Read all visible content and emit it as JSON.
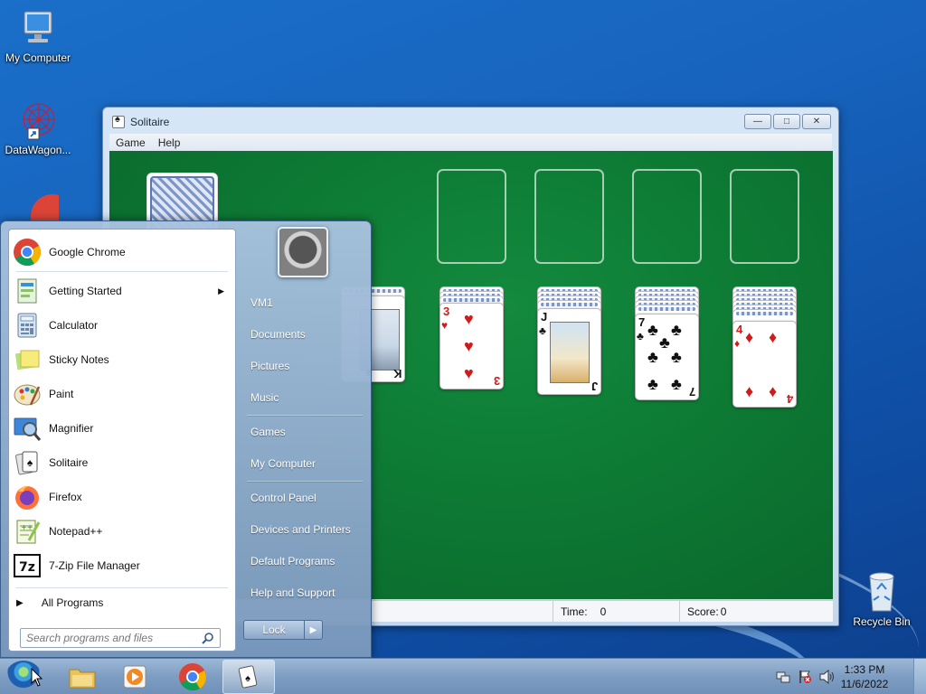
{
  "desktop": {
    "icons": [
      {
        "label": "My Computer",
        "icon": "computer-icon"
      },
      {
        "label": "DataWagon...",
        "icon": "datawagon-icon"
      },
      {
        "label": "Recycle Bin",
        "icon": "recycle-bin-icon"
      }
    ]
  },
  "solitaire": {
    "title": "Solitaire",
    "menu": [
      "Game",
      "Help"
    ],
    "status": {
      "time_label": "Time:",
      "time_value": "0",
      "score_label": "Score:",
      "score_value": "0"
    },
    "visible_cards": [
      {
        "rank": "K",
        "suit": "spades"
      },
      {
        "rank": "3",
        "suit": "hearts"
      },
      {
        "rank": "J",
        "suit": "clubs"
      },
      {
        "rank": "7",
        "suit": "clubs"
      },
      {
        "rank": "4",
        "suit": "diamonds"
      }
    ],
    "colors": {
      "felt": "#0d7a34",
      "red_suit": "#d21a1a"
    }
  },
  "start_menu": {
    "programs": [
      {
        "label": "Google Chrome",
        "icon": "chrome-icon"
      },
      {
        "label": "Getting Started",
        "icon": "getting-started-icon",
        "submenu": true
      },
      {
        "label": "Calculator",
        "icon": "calculator-icon"
      },
      {
        "label": "Sticky Notes",
        "icon": "sticky-notes-icon"
      },
      {
        "label": "Paint",
        "icon": "paint-icon"
      },
      {
        "label": "Magnifier",
        "icon": "magnifier-icon"
      },
      {
        "label": "Solitaire",
        "icon": "solitaire-icon"
      },
      {
        "label": "Firefox",
        "icon": "firefox-icon"
      },
      {
        "label": "Notepad++",
        "icon": "notepadpp-icon"
      },
      {
        "label": "7-Zip File Manager",
        "icon": "7zip-icon"
      }
    ],
    "all_programs": "All Programs",
    "search_placeholder": "Search programs and files",
    "right_links": [
      "VM1",
      "Documents",
      "Pictures",
      "Music",
      "Games",
      "My Computer",
      "Control Panel",
      "Devices and Printers",
      "Default Programs",
      "Help and Support"
    ],
    "lock_label": "Lock"
  },
  "taskbar": {
    "pinned": [
      "explorer-icon",
      "media-player-icon",
      "chrome-icon",
      "solitaire-icon"
    ],
    "clock": {
      "time": "1:33 PM",
      "date": "11/6/2022"
    }
  }
}
